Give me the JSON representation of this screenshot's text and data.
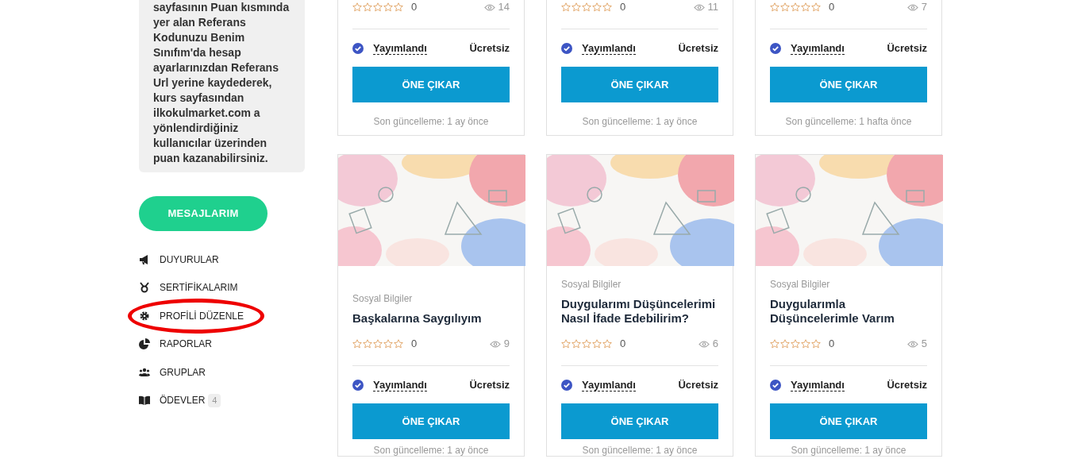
{
  "sidebar": {
    "info_text": "sayfasının Puan kısmında yer alan Referans Kodunuzu Benim Sınıfım'da hesap ayarlarınızdan Referans Url yerine kaydederek, kurs sayfasından ilkokulmarket.com a yönlendirdiğiniz kullanıcılar üzerinden puan kazanabilirsiniz.",
    "messages_button": "MESAJLARIM",
    "menu": [
      {
        "label": "DUYURULAR",
        "circled": false
      },
      {
        "label": "SERTİFİKALARIM",
        "circled": false
      },
      {
        "label": "PROFİLİ DÜZENLE",
        "circled": true
      },
      {
        "label": "RAPORLAR",
        "circled": false
      },
      {
        "label": "GRUPLAR",
        "circled": false
      },
      {
        "label": "ÖDEVLER",
        "badge": "4",
        "circled": false
      }
    ]
  },
  "top_cards": [
    {
      "stars": 0,
      "rating": "0",
      "views": "14",
      "status": "Yayımlandı",
      "price": "Ücretsiz",
      "button": "ÖNE ÇIKAR",
      "updated": "Son güncelleme: 1 ay önce"
    },
    {
      "stars": 0,
      "rating": "0",
      "views": "11",
      "status": "Yayımlandı",
      "price": "Ücretsiz",
      "button": "ÖNE ÇIKAR",
      "updated": "Son güncelleme: 1 ay önce"
    },
    {
      "stars": 0,
      "rating": "0",
      "views": "7",
      "status": "Yayımlandı",
      "price": "Ücretsiz",
      "button": "ÖNE ÇIKAR",
      "updated": "Son güncelleme: 1 hafta önce"
    }
  ],
  "bottom_cards": [
    {
      "category": "Sosyal Bilgiler",
      "title": "Başkalarına Saygılıyım",
      "stars": 0,
      "rating": "0",
      "views": "9",
      "status": "Yayımlandı",
      "price": "Ücretsiz",
      "button": "ÖNE ÇIKAR",
      "updated": "Son güncelleme: 1 ay önce"
    },
    {
      "category": "Sosyal Bilgiler",
      "title": "Duygularımı Düşüncelerimi Nasıl İfade Edebilirim?",
      "stars": 0,
      "rating": "0",
      "views": "6",
      "status": "Yayımlandı",
      "price": "Ücretsiz",
      "button": "ÖNE ÇIKAR",
      "updated": "Son güncelleme: 1 ay önce"
    },
    {
      "category": "Sosyal Bilgiler",
      "title": "Duygularımla Düşüncelerimle Varım",
      "stars": 0,
      "rating": "0",
      "views": "5",
      "status": "Yayımlandı",
      "price": "Ücretsiz",
      "button": "ÖNE ÇIKAR",
      "updated": "Son güncelleme: 1 ay önce"
    }
  ]
}
